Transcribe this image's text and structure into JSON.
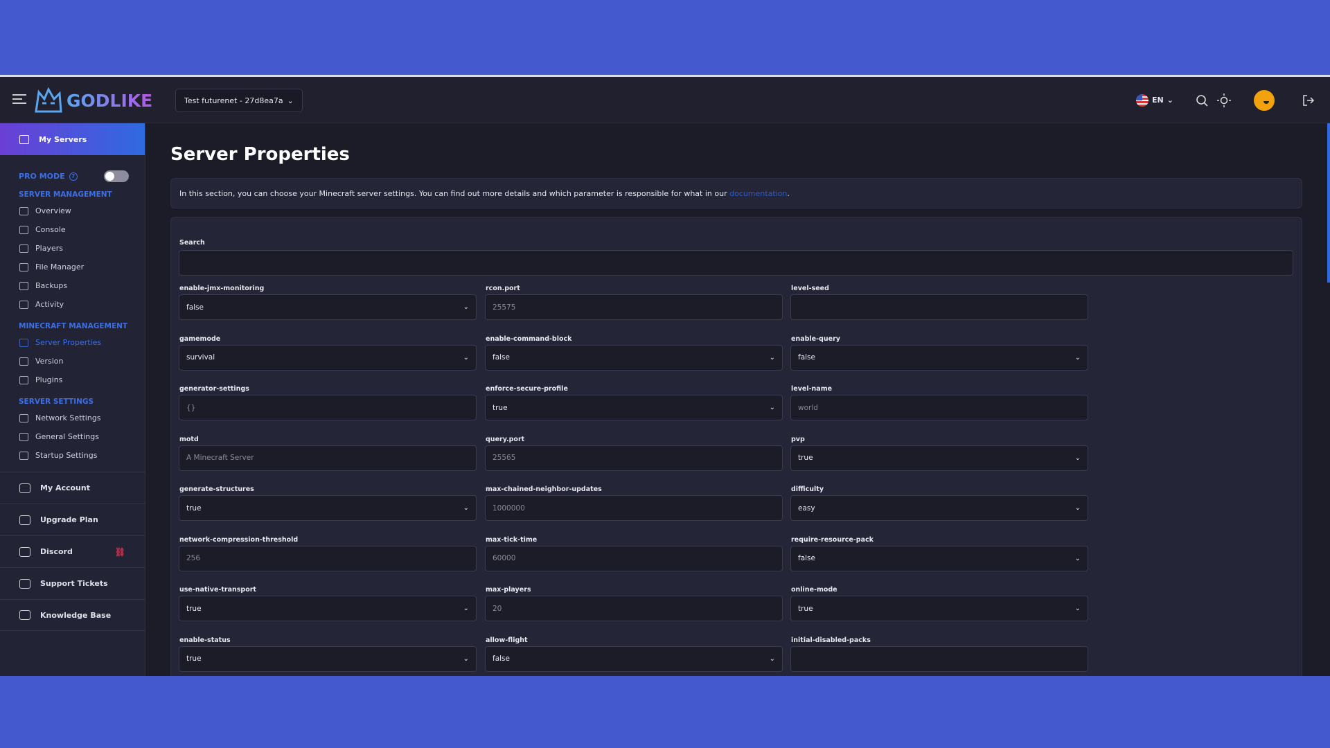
{
  "header": {
    "logo_text": "GODLIKE",
    "server": "Test futurenet - 27d8ea7a",
    "lang": "EN"
  },
  "sidebar": {
    "my_servers": "My Servers",
    "pro_mode": "PRO MODE",
    "pro_mode_on": false,
    "sections": [
      {
        "title": "SERVER MANAGEMENT",
        "items": [
          "Overview",
          "Console",
          "Players",
          "File Manager",
          "Backups",
          "Activity"
        ]
      },
      {
        "title": "MINECRAFT MANAGEMENT",
        "items": [
          "Server Properties",
          "Version",
          "Plugins"
        ]
      },
      {
        "title": "SERVER SETTINGS",
        "items": [
          "Network Settings",
          "General Settings",
          "Startup Settings"
        ]
      }
    ],
    "active": "Server Properties",
    "bottom": [
      "My Account",
      "Upgrade Plan",
      "Discord",
      "Support Tickets",
      "Knowledge Base"
    ]
  },
  "main": {
    "title": "Server Properties",
    "info_text": "In this section, you can choose your Minecraft server settings. You can find out more details and which parameter is responsible for what in our ",
    "info_link": "documentation",
    "info_end": ".",
    "search_label": "Search",
    "search_value": "",
    "fields": [
      {
        "label": "enable-jmx-monitoring",
        "type": "select",
        "value": "false"
      },
      {
        "label": "rcon.port",
        "type": "input",
        "value": "25575"
      },
      {
        "label": "level-seed",
        "type": "input",
        "value": ""
      },
      {
        "label": "gamemode",
        "type": "select",
        "value": "survival"
      },
      {
        "label": "enable-command-block",
        "type": "select",
        "value": "false"
      },
      {
        "label": "enable-query",
        "type": "select",
        "value": "false"
      },
      {
        "label": "generator-settings",
        "type": "input",
        "value": "{}"
      },
      {
        "label": "enforce-secure-profile",
        "type": "select",
        "value": "true"
      },
      {
        "label": "level-name",
        "type": "input",
        "value": "world"
      },
      {
        "label": "motd",
        "type": "input",
        "value": "A Minecraft Server"
      },
      {
        "label": "query.port",
        "type": "input",
        "value": "25565"
      },
      {
        "label": "pvp",
        "type": "select",
        "value": "true"
      },
      {
        "label": "generate-structures",
        "type": "select",
        "value": "true"
      },
      {
        "label": "max-chained-neighbor-updates",
        "type": "input",
        "value": "1000000"
      },
      {
        "label": "difficulty",
        "type": "select",
        "value": "easy"
      },
      {
        "label": "network-compression-threshold",
        "type": "input",
        "value": "256"
      },
      {
        "label": "max-tick-time",
        "type": "input",
        "value": "60000"
      },
      {
        "label": "require-resource-pack",
        "type": "select",
        "value": "false"
      },
      {
        "label": "use-native-transport",
        "type": "select",
        "value": "true"
      },
      {
        "label": "max-players",
        "type": "input",
        "value": "20"
      },
      {
        "label": "online-mode",
        "type": "select",
        "value": "true"
      },
      {
        "label": "enable-status",
        "type": "select",
        "value": "true"
      },
      {
        "label": "allow-flight",
        "type": "select",
        "value": "false"
      },
      {
        "label": "initial-disabled-packs",
        "type": "input",
        "value": ""
      }
    ]
  },
  "colors": {
    "accent": "#3b6fe6",
    "background": "#4559cf",
    "avatar": "#f2a20c"
  }
}
